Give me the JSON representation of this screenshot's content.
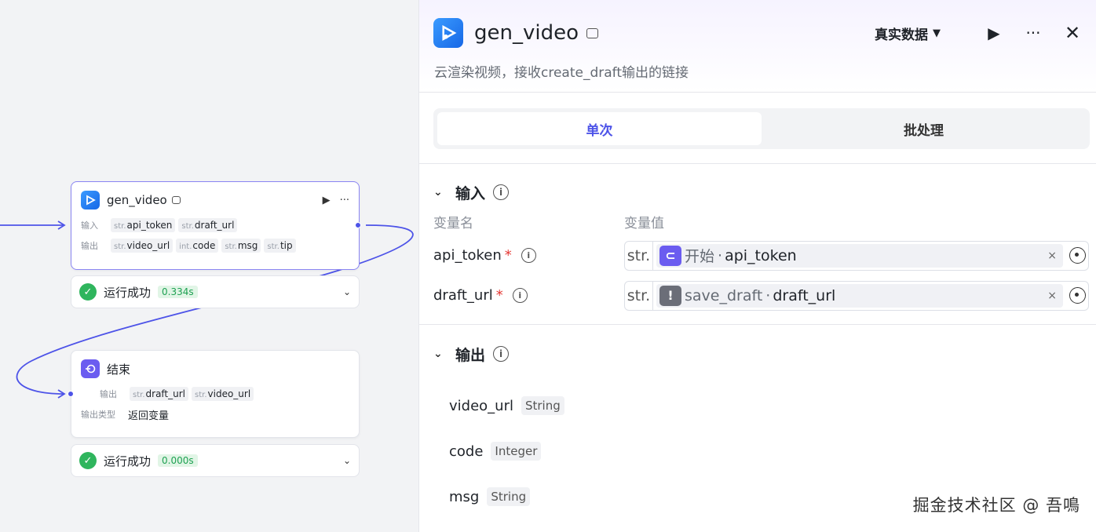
{
  "canvas": {
    "gen_node": {
      "title": "gen_video",
      "input_label": "输入",
      "inputs": [
        {
          "type": "str.",
          "name": "api_token"
        },
        {
          "type": "str.",
          "name": "draft_url"
        }
      ],
      "output_label": "输出",
      "outputs": [
        {
          "type": "str.",
          "name": "video_url"
        },
        {
          "type": "int.",
          "name": "code"
        },
        {
          "type": "str.",
          "name": "msg"
        },
        {
          "type": "str.",
          "name": "tip"
        }
      ],
      "status": "运行成功",
      "time": "0.334s"
    },
    "end_node": {
      "title": "结束",
      "output_label": "输出",
      "outputs": [
        {
          "type": "str.",
          "name": "draft_url"
        },
        {
          "type": "str.",
          "name": "video_url"
        }
      ],
      "output_type_label": "输出类型",
      "output_type_value": "返回变量",
      "status": "运行成功",
      "time": "0.000s"
    }
  },
  "panel": {
    "title": "gen_video",
    "data_mode": "真实数据",
    "description": "云渲染视频，接收create_draft输出的链接",
    "tabs": [
      "单次",
      "批处理"
    ],
    "input_section": {
      "title": "输入",
      "col_name": "变量名",
      "col_value": "变量值",
      "rows": [
        {
          "name": "api_token",
          "required": "*",
          "type": "str.",
          "ref_node": "开始",
          "sep": "·",
          "ref_var": "api_token",
          "clear": "×"
        },
        {
          "name": "draft_url",
          "required": "*",
          "type": "str.",
          "ref_node": "save_draft",
          "sep": "·",
          "ref_var": "draft_url",
          "clear": "×"
        }
      ]
    },
    "output_section": {
      "title": "输出",
      "rows": [
        {
          "name": "video_url",
          "type": "String"
        },
        {
          "name": "code",
          "type": "Integer"
        },
        {
          "name": "msg",
          "type": "String"
        }
      ]
    }
  },
  "watermark": "掘金技术社区 @ 吾鳴",
  "colors": {
    "accent": "#4d53e8",
    "success": "#2fb55d",
    "edge": "#4d53e8"
  }
}
